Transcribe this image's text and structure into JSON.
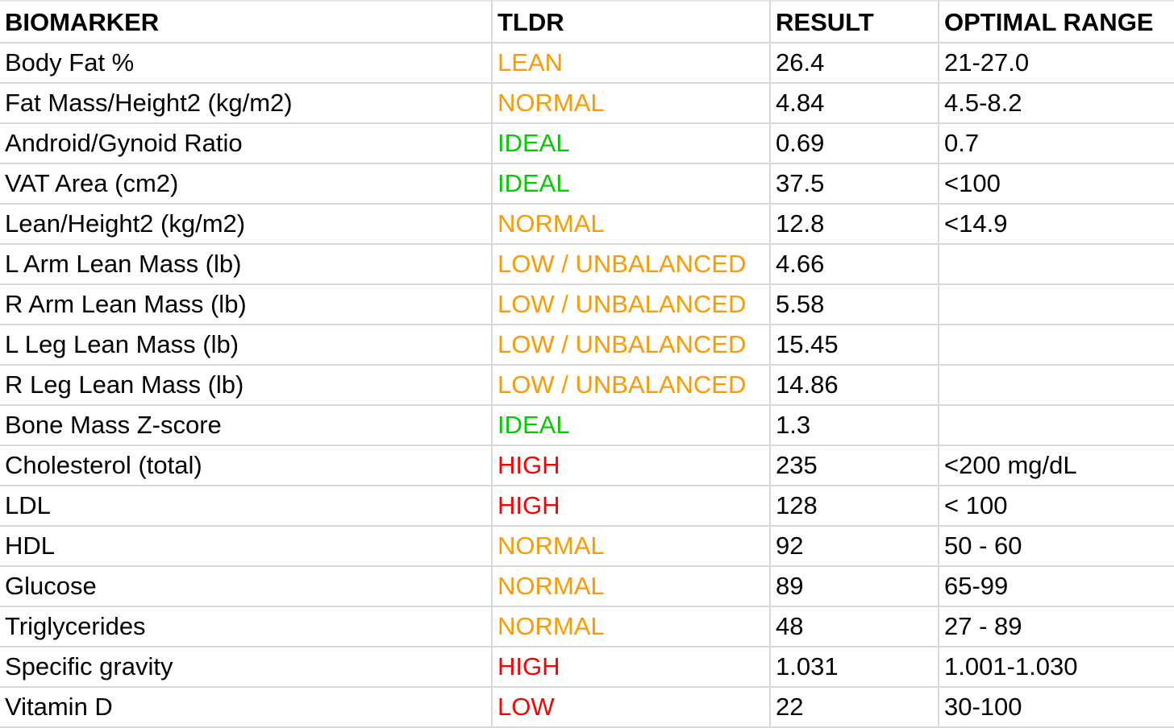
{
  "colors": {
    "orange": "#ff9900",
    "green": "#00cc00",
    "red": "#ff0000",
    "text": "#000000",
    "gridline": "#d9d9d9"
  },
  "table": {
    "headers": [
      "BIOMARKER",
      "TLDR",
      "RESULT",
      "OPTIMAL RANGE"
    ],
    "rows": [
      {
        "biomarker": "Body Fat %",
        "tldr": "LEAN",
        "status": "orange",
        "result": "26.4",
        "range": "21-27.0"
      },
      {
        "biomarker": "Fat Mass/Height2 (kg/m2)",
        "tldr": "NORMAL",
        "status": "orange",
        "result": "4.84",
        "range": "4.5-8.2"
      },
      {
        "biomarker": "Android/Gynoid Ratio",
        "tldr": "IDEAL",
        "status": "green",
        "result": "0.69",
        "range": "0.7"
      },
      {
        "biomarker": "VAT Area (cm2)",
        "tldr": "IDEAL",
        "status": "green",
        "result": "37.5",
        "range": "<100"
      },
      {
        "biomarker": "Lean/Height2 (kg/m2)",
        "tldr": "NORMAL",
        "status": "orange",
        "result": "12.8",
        "range": "<14.9"
      },
      {
        "biomarker": "L Arm Lean Mass (lb)",
        "tldr": "LOW / UNBALANCED",
        "status": "orange",
        "result": "4.66",
        "range": ""
      },
      {
        "biomarker": "R Arm Lean Mass (lb)",
        "tldr": "LOW / UNBALANCED",
        "status": "orange",
        "result": "5.58",
        "range": ""
      },
      {
        "biomarker": "L Leg Lean Mass (lb)",
        "tldr": "LOW / UNBALANCED",
        "status": "orange",
        "result": "15.45",
        "range": ""
      },
      {
        "biomarker": "R Leg Lean Mass (lb)",
        "tldr": "LOW / UNBALANCED",
        "status": "orange",
        "result": "14.86",
        "range": ""
      },
      {
        "biomarker": "Bone Mass Z-score",
        "tldr": "IDEAL",
        "status": "green",
        "result": "1.3",
        "range": ""
      },
      {
        "biomarker": "Cholesterol (total)",
        "tldr": "HIGH",
        "status": "red",
        "result": "235",
        "range": "<200 mg/dL"
      },
      {
        "biomarker": "LDL",
        "tldr": "HIGH",
        "status": "red",
        "result": "128",
        "range": "< 100"
      },
      {
        "biomarker": "HDL",
        "tldr": "NORMAL",
        "status": "orange",
        "result": "92",
        "range": "50 - 60"
      },
      {
        "biomarker": "Glucose",
        "tldr": "NORMAL",
        "status": "orange",
        "result": "89",
        "range": "65-99"
      },
      {
        "biomarker": "Triglycerides",
        "tldr": "NORMAL",
        "status": "orange",
        "result": "48",
        "range": "27 - 89"
      },
      {
        "biomarker": "Specific gravity",
        "tldr": "HIGH",
        "status": "red",
        "result": "1.031",
        "range": "1.001-1.030"
      },
      {
        "biomarker": "Vitamin D",
        "tldr": "LOW",
        "status": "red",
        "result": "22",
        "range": "30-100"
      }
    ]
  }
}
